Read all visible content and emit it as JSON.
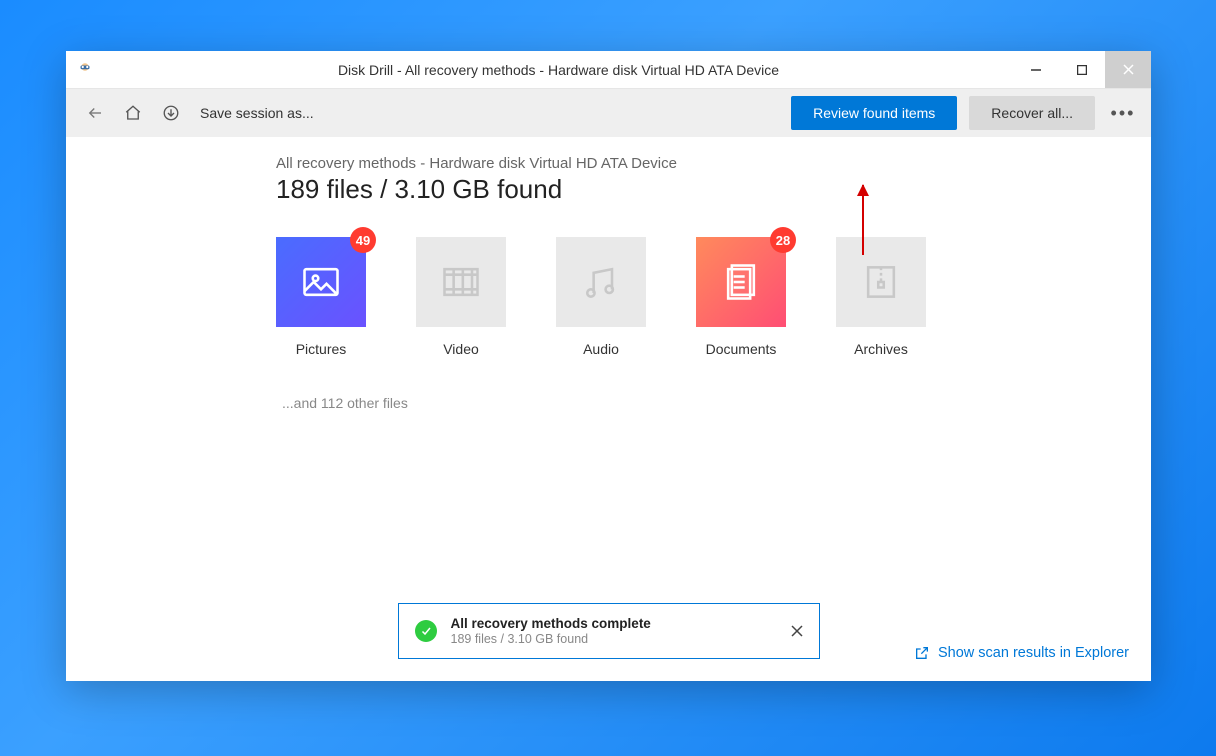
{
  "window": {
    "title": "Disk Drill - All recovery methods - Hardware disk Virtual HD ATA Device"
  },
  "toolbar": {
    "save_session": "Save session as...",
    "review_button": "Review found items",
    "recover_button": "Recover all...",
    "more": "•••"
  },
  "content": {
    "subtitle": "All recovery methods - Hardware disk Virtual HD ATA Device",
    "headline": "189 files / 3.10 GB found",
    "other_files": "...and 112 other files"
  },
  "categories": {
    "pictures": {
      "label": "Pictures",
      "badge": "49"
    },
    "video": {
      "label": "Video"
    },
    "audio": {
      "label": "Audio"
    },
    "documents": {
      "label": "Documents",
      "badge": "28"
    },
    "archives": {
      "label": "Archives"
    }
  },
  "status": {
    "title": "All recovery methods complete",
    "subtitle": "189 files / 3.10 GB found"
  },
  "footer": {
    "explorer_link": "Show scan results in Explorer"
  }
}
